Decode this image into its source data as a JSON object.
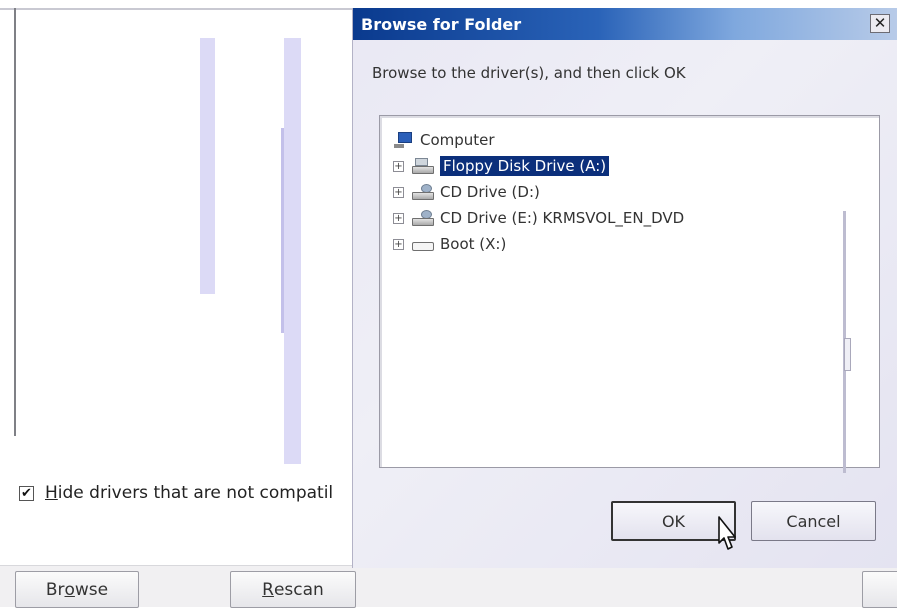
{
  "background_window": {
    "hide_incompatible": {
      "checked": true,
      "check_glyph": "✔",
      "label_prefix": "",
      "label_accel": "H",
      "label_rest": "ide drivers that are not compatil"
    },
    "buttons": {
      "browse": {
        "pre": "Br",
        "accel": "o",
        "post": "wse"
      },
      "rescan": {
        "pre": "",
        "accel": "R",
        "post": "escan"
      }
    }
  },
  "dialog": {
    "title": "Browse for Folder",
    "close_glyph": "✕",
    "instruction": "Browse to the driver(s), and then click OK",
    "tree": {
      "root": {
        "label": "Computer",
        "icon": "computer-icon"
      },
      "items": [
        {
          "label": "Floppy Disk Drive (A:)",
          "icon": "floppy-drive-icon",
          "selected": true,
          "expander": "+"
        },
        {
          "label": "CD Drive (D:)",
          "icon": "cd-drive-icon",
          "selected": false,
          "expander": "+"
        },
        {
          "label": "CD Drive (E:) KRMSVOL_EN_DVD",
          "icon": "cd-drive-icon",
          "selected": false,
          "expander": "+"
        },
        {
          "label": "Boot (X:)",
          "icon": "hard-drive-icon",
          "selected": false,
          "expander": "+"
        }
      ]
    },
    "ok_label": "OK",
    "cancel_label": "Cancel"
  },
  "colors": {
    "title_bar": "#0a3a8e",
    "selection": "#0b2f7b",
    "stripe": "#dcdaf6"
  }
}
